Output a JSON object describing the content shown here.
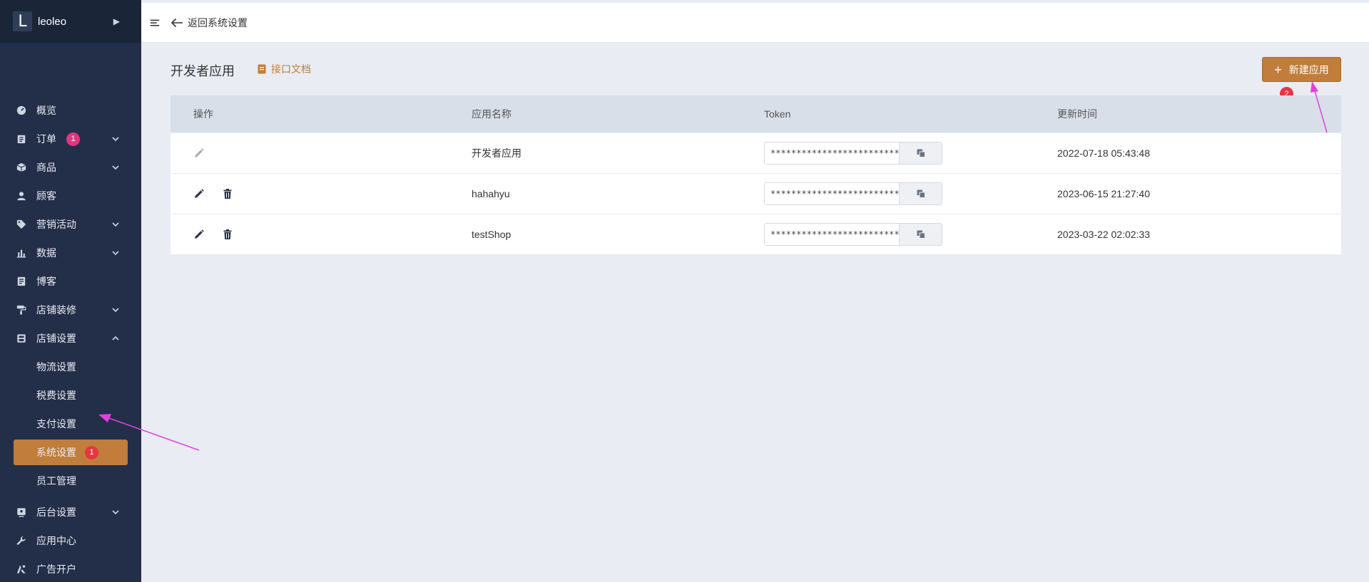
{
  "brand": {
    "logo_letter": "L",
    "name": "leoleo"
  },
  "sidebar": {
    "items": [
      {
        "label": "概览",
        "icon": "gauge-icon"
      },
      {
        "label": "订单",
        "icon": "clipboard-icon",
        "badge": "1",
        "has_children": true
      },
      {
        "label": "商品",
        "icon": "box-icon",
        "has_children": true
      },
      {
        "label": "顾客",
        "icon": "user-icon"
      },
      {
        "label": "营销活动",
        "icon": "tag-icon",
        "has_children": true
      },
      {
        "label": "数据",
        "icon": "bar-chart-icon",
        "has_children": true
      },
      {
        "label": "博客",
        "icon": "document-icon"
      },
      {
        "label": "店铺装修",
        "icon": "paint-roller-icon",
        "has_children": true
      },
      {
        "label": "店铺设置",
        "icon": "store-icon",
        "has_children": true,
        "expanded": true
      },
      {
        "label": "后台设置",
        "icon": "monitor-icon",
        "has_children": true
      },
      {
        "label": "应用中心",
        "icon": "wrench-icon"
      },
      {
        "label": "广告开户",
        "icon": "ads-icon"
      }
    ],
    "store_settings_children": [
      {
        "label": "物流设置"
      },
      {
        "label": "税费设置"
      },
      {
        "label": "支付设置"
      },
      {
        "label": "系统设置",
        "active": true,
        "marker": "1"
      },
      {
        "label": "员工管理"
      }
    ]
  },
  "topbar": {
    "back_label": "返回系统设置"
  },
  "page": {
    "title": "开发者应用",
    "docs_link": "接口文档",
    "new_app_button": "新建应用",
    "marker": "2"
  },
  "table": {
    "columns": [
      "操作",
      "应用名称",
      "Token",
      "更新时间"
    ],
    "rows": [
      {
        "name": "开发者应用",
        "token": "****************************",
        "updated": "2022-07-18 05:43:48",
        "deletable": false,
        "edit_disabled": true
      },
      {
        "name": "hahahyu",
        "token": "****************************",
        "updated": "2023-06-15 21:27:40",
        "deletable": true,
        "edit_disabled": false
      },
      {
        "name": "testShop",
        "token": "****************************",
        "updated": "2023-03-22 02:02:33",
        "deletable": true,
        "edit_disabled": false
      }
    ]
  },
  "colors": {
    "sidebar_bg": "#232f48",
    "brand_bg": "#1b2538",
    "accent": "#c07d3b",
    "badge_pink": "#e6357e",
    "marker_red": "#e8353f",
    "annotation_arrow": "#e040e0",
    "page_bg": "#e9ecf2",
    "table_header_bg": "#d9dfe8"
  }
}
